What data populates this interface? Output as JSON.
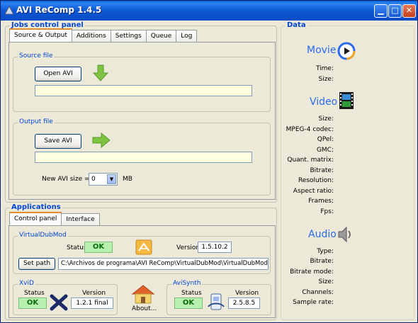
{
  "window": {
    "title": "AVI ReComp  1.4.5"
  },
  "jobs_panel": {
    "title": "Jobs control panel",
    "tabs": [
      {
        "label": "Source & Output"
      },
      {
        "label": "Additions"
      },
      {
        "label": "Settings"
      },
      {
        "label": "Queue"
      },
      {
        "label": "Log"
      }
    ],
    "source": {
      "title": "Source file",
      "button": "Open AVI",
      "path": ""
    },
    "output": {
      "title": "Output file",
      "button": "Save AVI",
      "path": "",
      "size_label": "New AVI size =",
      "size_value": "0",
      "size_unit": "MB"
    }
  },
  "applications": {
    "title": "Applications",
    "tabs": [
      {
        "label": "Control panel"
      },
      {
        "label": "Interface"
      }
    ],
    "vdm": {
      "title": "VirtualDubMod",
      "status_label": "Status",
      "status": "OK",
      "version_label": "Version",
      "version": "1.5.10.2",
      "set_path": "Set path",
      "path": "C:\\Archivos de programa\\AVI ReComp\\VirtualDubMod\\VirtualDubMod.ex"
    },
    "xvid": {
      "title": "XviD",
      "status_label": "Status",
      "status": "OK",
      "version_label": "Version",
      "version": "1.2.1 final"
    },
    "about": {
      "label": "About..."
    },
    "avisynth": {
      "title": "AviSynth",
      "status_label": "Status",
      "status": "OK",
      "version_label": "Version",
      "version": "2.5.8.5"
    }
  },
  "data_panel": {
    "title": "Data",
    "movie": {
      "title": "Movie",
      "fields": [
        "Time:",
        "Size:"
      ]
    },
    "video": {
      "title": "Video",
      "fields": [
        "Size:",
        "MPEG-4 codec:",
        "QPel:",
        "GMC:",
        "Quant. matrix:",
        "Bitrate:",
        "Resolution:",
        "Aspect ratio:",
        "Frames:",
        "Fps:"
      ]
    },
    "audio": {
      "title": "Audio",
      "fields": [
        "Type:",
        "Bitrate:",
        "Bitrate mode:",
        "Size:",
        "Channels:",
        "Sample rate:"
      ]
    }
  }
}
